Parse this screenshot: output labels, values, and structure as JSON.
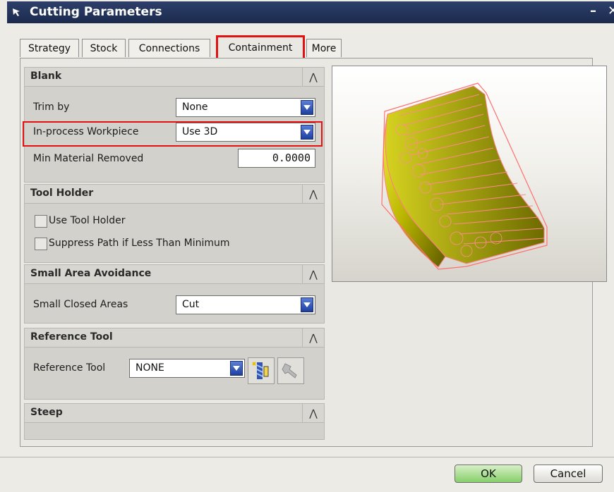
{
  "window": {
    "title": "Cutting Parameters",
    "minimize": "–",
    "close": "✕"
  },
  "tabs": [
    {
      "label": "Strategy"
    },
    {
      "label": "Stock"
    },
    {
      "label": "Connections"
    },
    {
      "label": "Containment",
      "active": true
    },
    {
      "label": "More"
    }
  ],
  "blank": {
    "header": "Blank",
    "trim_by": {
      "label": "Trim by",
      "value": "None"
    },
    "inprocess": {
      "label": "In-process Workpiece",
      "value": "Use 3D"
    },
    "min_material": {
      "label": "Min Material Removed",
      "value": "0.0000"
    }
  },
  "tool_holder": {
    "header": "Tool Holder",
    "use_tool_holder": {
      "label": "Use Tool Holder",
      "checked": false
    },
    "suppress_path": {
      "label": "Suppress Path if Less Than Minimum",
      "checked": false
    }
  },
  "small_area": {
    "header": "Small Area Avoidance",
    "small_closed": {
      "label": "Small Closed Areas",
      "value": "Cut"
    }
  },
  "reference_tool": {
    "header": "Reference Tool",
    "ref_tool": {
      "label": "Reference Tool",
      "value": "NONE"
    }
  },
  "steep": {
    "header": "Steep"
  },
  "collapse_glyph": "⋀",
  "buttons": {
    "ok": "OK",
    "cancel": "Cancel"
  },
  "colors": {
    "accent_red": "#e21212",
    "title_bar": "#1b2a4d",
    "part_yellow": "#c8c400",
    "ok_green": "#86cf6b"
  }
}
